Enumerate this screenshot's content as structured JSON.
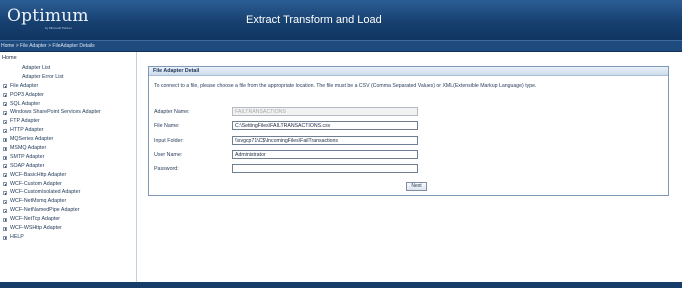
{
  "header": {
    "logo_text": "Optimum",
    "logo_subtext": "by Microsoft Partner",
    "app_title": "Extract Transform and Load"
  },
  "breadcrumb": "Home > File Adapter > FileAdapter Details",
  "sidebar": {
    "home_label": "Home",
    "items": [
      {
        "label": "Adapter List",
        "expandable": false
      },
      {
        "label": "Adapter Error List",
        "expandable": false
      },
      {
        "label": "File Adapter",
        "expandable": true
      },
      {
        "label": "POP3 Adapter",
        "expandable": true
      },
      {
        "label": "SQL Adapter",
        "expandable": true
      },
      {
        "label": "Windows SharePoint Services Adapter",
        "expandable": true
      },
      {
        "label": "FTP Adapter",
        "expandable": true
      },
      {
        "label": "HTTP Adapter",
        "expandable": true
      },
      {
        "label": "MQSeries Adapter",
        "expandable": true
      },
      {
        "label": "MSMQ Adapter",
        "expandable": true
      },
      {
        "label": "SMTP Adapter",
        "expandable": true
      },
      {
        "label": "SOAP Adapter",
        "expandable": true
      },
      {
        "label": "WCF-BasicHttp Adapter",
        "expandable": true
      },
      {
        "label": "WCF-Custom Adapter",
        "expandable": true
      },
      {
        "label": "WCF-CustomIsolated Adapter",
        "expandable": true
      },
      {
        "label": "WCF-NetMsmq Adapter",
        "expandable": true
      },
      {
        "label": "WCF-NetNamedPipe Adapter",
        "expandable": true
      },
      {
        "label": "WCF-NetTcp Adapter",
        "expandable": true
      },
      {
        "label": "WCF-WSHttp Adapter",
        "expandable": true
      },
      {
        "label": "HELP",
        "expandable": true
      }
    ]
  },
  "panel": {
    "title": "File Adapter Detail",
    "description": "To connect to a file, please choose a file from the appropriate location. The file must be a CSV (Comma Separated Values) or XML(Extensible Markup Language) type.",
    "fields": {
      "adapter_name": {
        "label": "Adapter Name:",
        "value": "FAILTRANSACTIONS"
      },
      "file_name": {
        "label": "File Name:",
        "value": "C:\\SettingFiles\\FAILTRANSACTIONS.csv"
      },
      "input_folder": {
        "label": "Input Folder:",
        "value": "\\\\svgcp71\\C$\\IncomingFiles\\FailTransactions"
      },
      "user_name": {
        "label": "User Name:",
        "value": "Administrator"
      },
      "password": {
        "label": "Password:",
        "value": ""
      }
    },
    "next_label": "Next"
  },
  "colors": {
    "header_blue": "#17406f",
    "breadcrumb_blue": "#1e4a7e",
    "panel_border": "#7f9ab9",
    "footer_blue": "#163c69"
  }
}
